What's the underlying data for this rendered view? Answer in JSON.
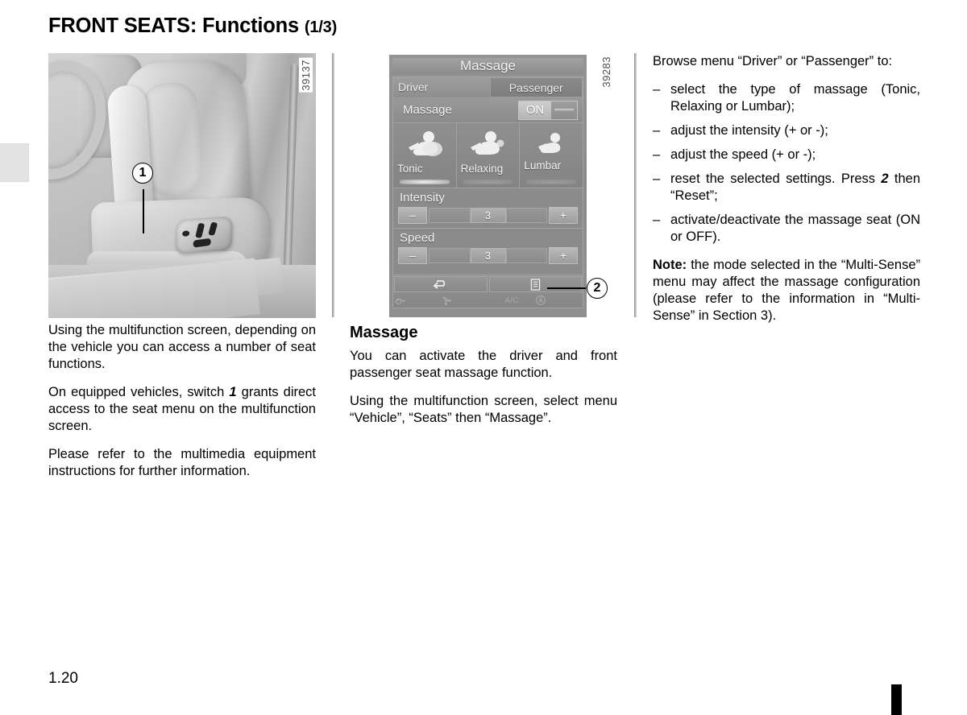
{
  "document": {
    "title_main": "FRONT SEATS: Functions",
    "title_fraction": "(1/3)",
    "page_number": "1.20"
  },
  "figures": {
    "seat_photo": {
      "ref": "39137",
      "callout": "1"
    },
    "screen_photo": {
      "ref": "39283",
      "callout": "2"
    }
  },
  "screen": {
    "title": "Massage",
    "tabs": [
      {
        "label": "Driver",
        "active": true
      },
      {
        "label": "Passenger",
        "active": false
      }
    ],
    "massage_row": {
      "label": "Massage",
      "toggle_value": "ON"
    },
    "modes": [
      {
        "label": "Tonic",
        "icon": "seat-massage-icon",
        "selected": true
      },
      {
        "label": "Relaxing",
        "icon": "seat-massage-icon",
        "selected": false
      },
      {
        "label": "Lumbar",
        "icon": "seat-massage-icon",
        "selected": false
      }
    ],
    "sliders": [
      {
        "label": "Intensity",
        "minus": "–",
        "plus": "+",
        "value": "3"
      },
      {
        "label": "Speed",
        "minus": "–",
        "plus": "+",
        "value": "3"
      }
    ],
    "bottom_buttons": [
      {
        "icon": "back-arrow-icon"
      },
      {
        "icon": "menu-list-icon"
      }
    ],
    "hvac_icons": [
      "air-recirculation-icon",
      "fan-icon",
      "ac-icon",
      "auto-icon"
    ],
    "hvac_ac_label": "A/C"
  },
  "column_left": {
    "paragraphs": [
      "Using the multifunction screen, depending on the vehicle you can access a number of seat functions.",
      "On equipped vehicles, switch 1 grants direct access to the seat menu on the multifunction screen.",
      "Please refer to the multimedia equipment instructions for further information."
    ],
    "p2_before": "On equipped vehicles, switch ",
    "p2_bold": "1",
    "p2_after": " grants direct access to the seat menu on the multifunction screen."
  },
  "column_middle": {
    "heading": "Massage",
    "paragraphs": [
      "You can activate the driver and front passenger seat massage function.",
      "Using the multifunction screen, select menu “Vehicle”, “Seats” then “Massage”."
    ]
  },
  "column_right": {
    "intro": "Browse menu “Driver” or “Passenger” to:",
    "bullets": [
      "select the type of massage (Tonic, Relaxing or Lumbar);",
      "adjust the intensity (+ or -);",
      "adjust the speed (+ or -);",
      "reset the selected settings. Press 2 then “Reset”;",
      "activate/deactivate the massage seat (ON or OFF)."
    ],
    "bullet4_before": "reset the selected settings. Press ",
    "bullet4_bold": "2",
    "bullet4_after": " then “Reset”;",
    "dash": "–",
    "note_label": "Note:",
    "note_text": " the mode selected in the “Multi-Sense” menu may affect the massage configuration (please refer to the information in “Multi-Sense” in Section 3)."
  },
  "colors": {
    "page_background": "#ffffff",
    "text": "#000000",
    "screen_background": "#8d8d8d",
    "edge_tab": "#e3e3e3",
    "marker": "#000000"
  }
}
